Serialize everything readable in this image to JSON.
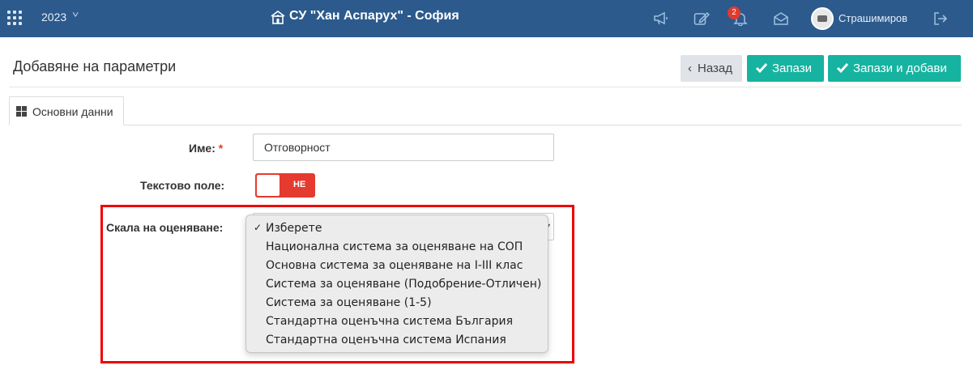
{
  "topbar": {
    "year": "2023",
    "school": "СУ \"Хан Аспарух\" - София",
    "notifications_count": "2",
    "username": "Страшимиров"
  },
  "page": {
    "title": "Добавяне на параметри"
  },
  "buttons": {
    "back": "Назад",
    "save": "Запази",
    "save_add": "Запази и добави"
  },
  "tabs": [
    {
      "label": "Основни данни"
    }
  ],
  "form": {
    "name_label": "Име:",
    "name_required": "*",
    "name_value": "Отговорност",
    "text_field_label": "Текстово поле:",
    "text_field_toggle": "НЕ",
    "scale_label": "Скала на оценяване:"
  },
  "dropdown": {
    "selected_mark": "✓",
    "options": [
      "Изберете",
      "Национална система за оценяване на СОП",
      "Основна система за оценяване на I-III клас",
      "Система за оценяване (Подобрение-Отличен)",
      "Система за оценяване (1-5)",
      "Стандартна оценъчна система България",
      "Стандартна оценъчна система Испания"
    ]
  },
  "colors": {
    "topbar": "#2c5a8c",
    "accent": "#16b3a0",
    "danger": "#e53a2f",
    "highlight": "#ee0000"
  }
}
